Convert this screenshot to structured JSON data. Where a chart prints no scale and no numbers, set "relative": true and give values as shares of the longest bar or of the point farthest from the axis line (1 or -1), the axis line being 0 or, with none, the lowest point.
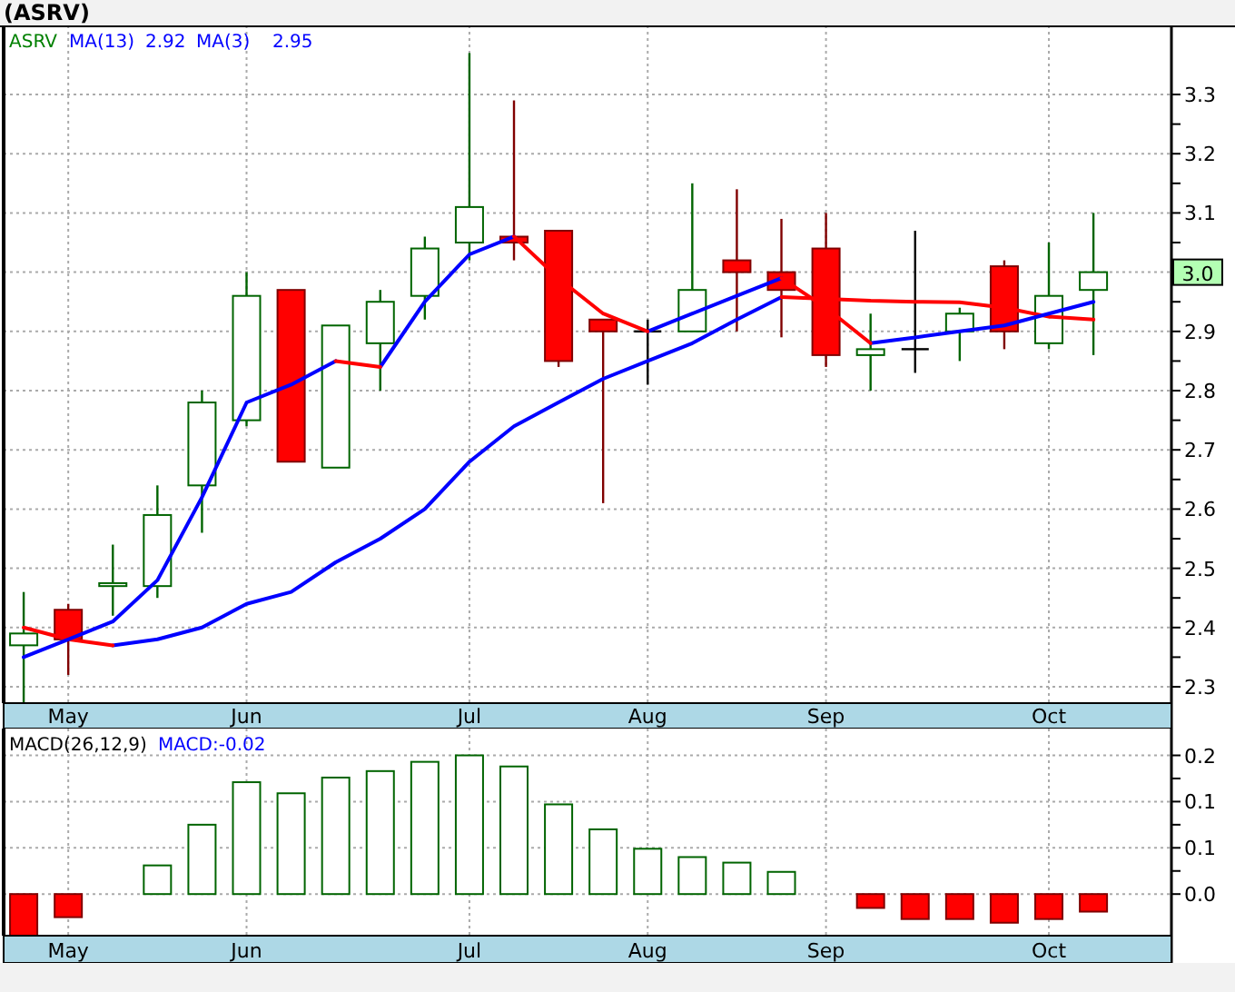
{
  "title": "(ASRV)",
  "price_chart": {
    "legend": {
      "symbol": "ASRV",
      "indicators": [
        {
          "label": "MA(13)",
          "value": "2.92"
        },
        {
          "label": "MA(3)",
          "value": "2.95"
        }
      ]
    },
    "last_price": "3.0",
    "chart_data": {
      "type": "candlestick",
      "grid": true,
      "categories": [
        null,
        "May",
        null,
        null,
        null,
        "Jun",
        null,
        null,
        null,
        null,
        "Jul",
        null,
        null,
        null,
        "Aug",
        null,
        null,
        null,
        "Sep",
        null,
        null,
        null,
        null,
        "Oct",
        null
      ],
      "ylim": [
        2.2724,
        3.4166
      ],
      "yticks": [
        2.3,
        2.4,
        2.5,
        2.6,
        2.7,
        2.8,
        2.9,
        3.1,
        3.2,
        3.3
      ],
      "ohlc": [
        [
          2.37,
          2.46,
          2.27,
          2.39
        ],
        [
          2.43,
          2.44,
          2.32,
          2.38
        ],
        [
          2.47,
          2.54,
          2.42,
          2.475
        ],
        [
          2.47,
          2.64,
          2.45,
          2.59
        ],
        [
          2.64,
          2.8,
          2.56,
          2.78
        ],
        [
          2.75,
          3.0,
          2.74,
          2.96
        ],
        [
          2.97,
          2.97,
          2.68,
          2.68
        ],
        [
          2.67,
          2.91,
          2.67,
          2.91
        ],
        [
          2.88,
          2.97,
          2.8,
          2.95
        ],
        [
          2.96,
          3.06,
          2.92,
          3.04
        ],
        [
          3.05,
          3.37,
          3.02,
          3.11
        ],
        [
          3.06,
          3.29,
          3.02,
          3.05
        ],
        [
          3.07,
          3.07,
          2.84,
          2.85
        ],
        [
          2.92,
          2.92,
          2.61,
          2.9
        ],
        [
          2.9,
          2.92,
          2.81,
          2.9
        ],
        [
          2.9,
          3.15,
          2.9,
          2.97
        ],
        [
          3.02,
          3.14,
          2.9,
          3.0
        ],
        [
          3.0,
          3.09,
          2.89,
          2.97
        ],
        [
          3.04,
          3.1,
          2.84,
          2.86
        ],
        [
          2.86,
          2.93,
          2.8,
          2.87
        ],
        [
          2.87,
          3.07,
          2.83,
          2.87
        ],
        [
          2.9,
          2.94,
          2.85,
          2.93
        ],
        [
          3.01,
          3.02,
          2.87,
          2.9
        ],
        [
          2.88,
          3.05,
          2.87,
          2.96
        ],
        [
          2.97,
          3.1,
          2.86,
          3.0
        ]
      ]
    },
    "moving_averages": {
      "chart_data": {
        "type": "line",
        "relative": true,
        "ylim": [
          2.2724,
          3.4166
        ],
        "series": [
          {
            "color": "#0000ff",
            "values": [
              null,
              null,
              2.37,
              2.38,
              2.4,
              2.44,
              2.46,
              2.51,
              2.55,
              2.6,
              2.68,
              2.74,
              2.78,
              2.82,
              2.85,
              2.88,
              2.92,
              2.958,
              null,
              null,
              null,
              null,
              null,
              null,
              null
            ]
          },
          {
            "color": "#ff0000",
            "values": [
              2.4,
              2.38,
              2.37,
              null,
              null,
              null,
              null,
              null,
              null,
              null,
              null,
              null,
              null,
              null,
              null,
              null,
              null,
              2.958,
              2.955,
              2.952,
              2.95,
              2.949,
              2.94,
              2.925,
              2.92
            ]
          },
          {
            "color": "#0000ff",
            "values": [
              2.35,
              2.38,
              2.41,
              2.48,
              2.62,
              2.78,
              2.81,
              2.85,
              2.84,
              2.95,
              3.03,
              3.06,
              null,
              null,
              2.9,
              2.93,
              2.96,
              2.99,
              null,
              2.88,
              2.89,
              2.9,
              2.91,
              2.93,
              2.95
            ]
          },
          {
            "color": "#ff0000",
            "values": [
              null,
              null,
              null,
              null,
              null,
              null,
              null,
              2.85,
              2.84,
              null,
              null,
              3.06,
              2.99,
              2.93,
              2.9,
              null,
              null,
              2.99,
              2.94,
              2.88,
              null,
              null,
              null,
              null,
              null
            ]
          }
        ]
      }
    }
  },
  "macd_chart": {
    "legend": {
      "label": "MACD(26,12,9)",
      "value": "MACD:-0.02"
    },
    "chart_data": {
      "type": "bar",
      "grid": true,
      "categories": [
        null,
        "May",
        null,
        null,
        null,
        "Jun",
        null,
        null,
        null,
        null,
        "Jul",
        null,
        null,
        null,
        "Aug",
        null,
        null,
        null,
        "Sep",
        null,
        null,
        null,
        null,
        "Oct",
        null
      ],
      "ylim": [
        -0.045,
        0.179
      ],
      "yticks": [
        {
          "value": 0,
          "label": "0.0"
        },
        {
          "value": 0.05,
          "label": "0.1"
        },
        {
          "value": 0.1,
          "label": "0.1"
        },
        {
          "value": 0.15,
          "label": "0.2"
        }
      ],
      "series": [
        {
          "color": "#006400",
          "values": [
            null,
            null,
            0,
            0.031,
            0.075,
            0.121,
            0.109,
            0.126,
            0.133,
            0.143,
            0.15,
            0.138,
            0.097,
            0.07,
            0.049,
            0.04,
            0.034,
            0.024,
            0,
            null,
            null,
            null,
            null,
            null,
            null
          ]
        },
        {
          "color": "#ff0000",
          "values": [
            -0.045,
            -0.025,
            null,
            null,
            null,
            null,
            null,
            null,
            null,
            null,
            null,
            null,
            null,
            null,
            null,
            null,
            null,
            null,
            null,
            -0.015,
            -0.027,
            -0.027,
            -0.031,
            -0.027,
            -0.019
          ]
        }
      ]
    }
  }
}
